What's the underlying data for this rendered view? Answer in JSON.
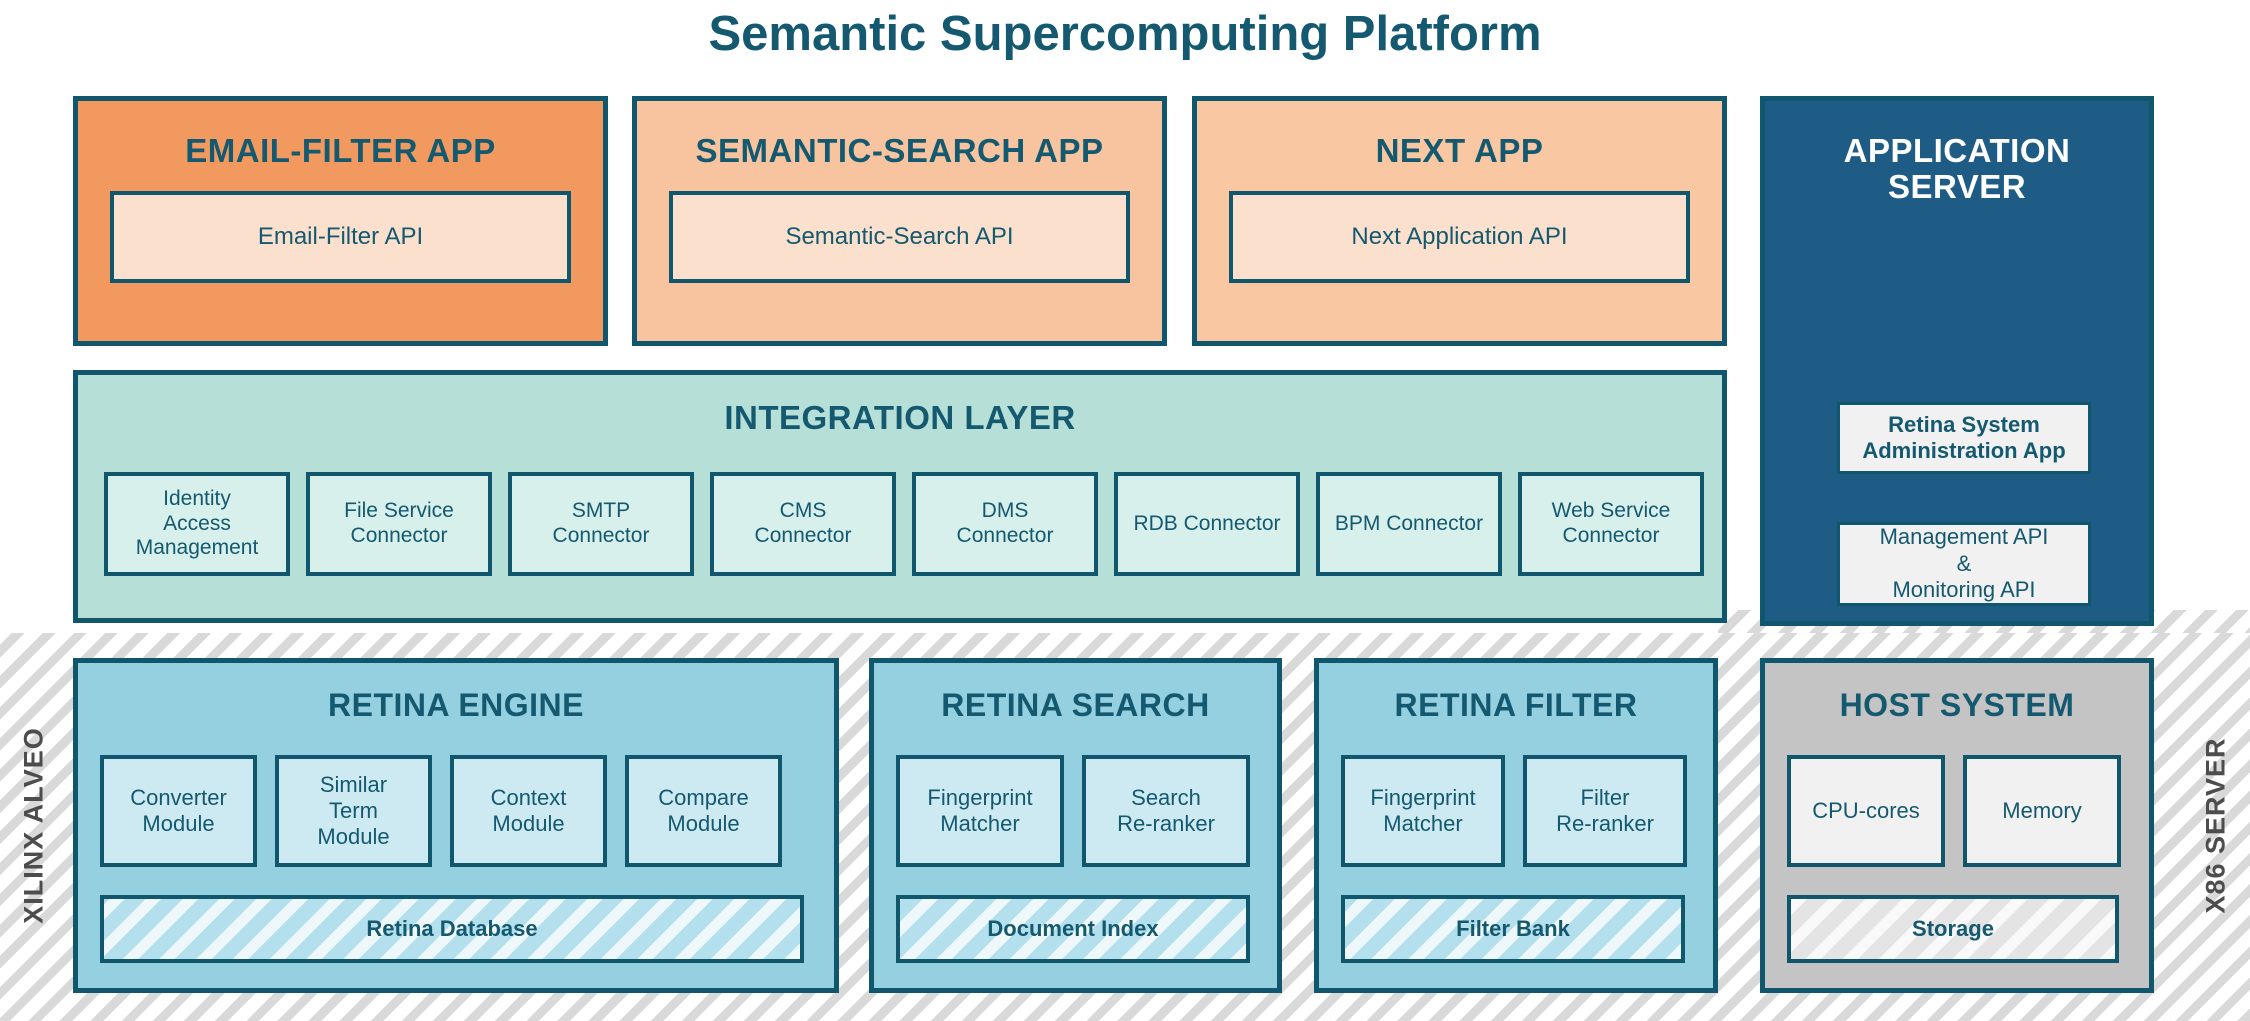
{
  "title": "Semantic Supercomputing Platform",
  "side_labels": {
    "left": "XILINX ALVEO",
    "right": "X86 SERVER"
  },
  "colors": {
    "dark_teal": "#10576e",
    "title_teal": "#14596f",
    "app_primary_orange": "#f2995f",
    "app_secondary_orange": "#f7c49f",
    "api_box": "#fbe0cd",
    "server_blue": "#1f5c85",
    "integration_mint": "#b6dfd8",
    "connector_mint": "#d8f0ec",
    "hardware_blue": "#95d0e0",
    "module_blue": "#cdeaf2",
    "host_gray": "#c4c4c4",
    "stripe_gray": "#d9d9d9"
  },
  "apps": [
    {
      "title": "EMAIL-FILTER APP",
      "api": "Email-Filter API"
    },
    {
      "title": "SEMANTIC-SEARCH APP",
      "api": "Semantic-Search API"
    },
    {
      "title": "NEXT APP",
      "api": "Next Application API"
    }
  ],
  "application_server": {
    "title": "APPLICATION\nSERVER",
    "boxes": [
      "Retina System\nAdministration App",
      "Management API\n&\nMonitoring API"
    ]
  },
  "integration_layer": {
    "title": "INTEGRATION LAYER",
    "connectors": [
      "Identity\nAccess\nManagement",
      "File Service\nConnector",
      "SMTP\nConnector",
      "CMS\nConnector",
      "DMS\nConnector",
      "RDB Connector",
      "BPM Connector",
      "Web Service\nConnector"
    ]
  },
  "hardware": [
    {
      "title": "RETINA ENGINE",
      "modules": [
        "Converter\nModule",
        "Similar\nTerm\nModule",
        "Context\nModule",
        "Compare\nModule"
      ],
      "store": "Retina Database"
    },
    {
      "title": "RETINA SEARCH",
      "modules": [
        "Fingerprint\nMatcher",
        "Search\nRe-ranker"
      ],
      "store": "Document Index"
    },
    {
      "title": "RETINA FILTER",
      "modules": [
        "Fingerprint\nMatcher",
        "Filter\nRe-ranker"
      ],
      "store": "Filter Bank"
    },
    {
      "title": "HOST SYSTEM",
      "modules": [
        "CPU-cores",
        "Memory"
      ],
      "store": "Storage"
    }
  ]
}
